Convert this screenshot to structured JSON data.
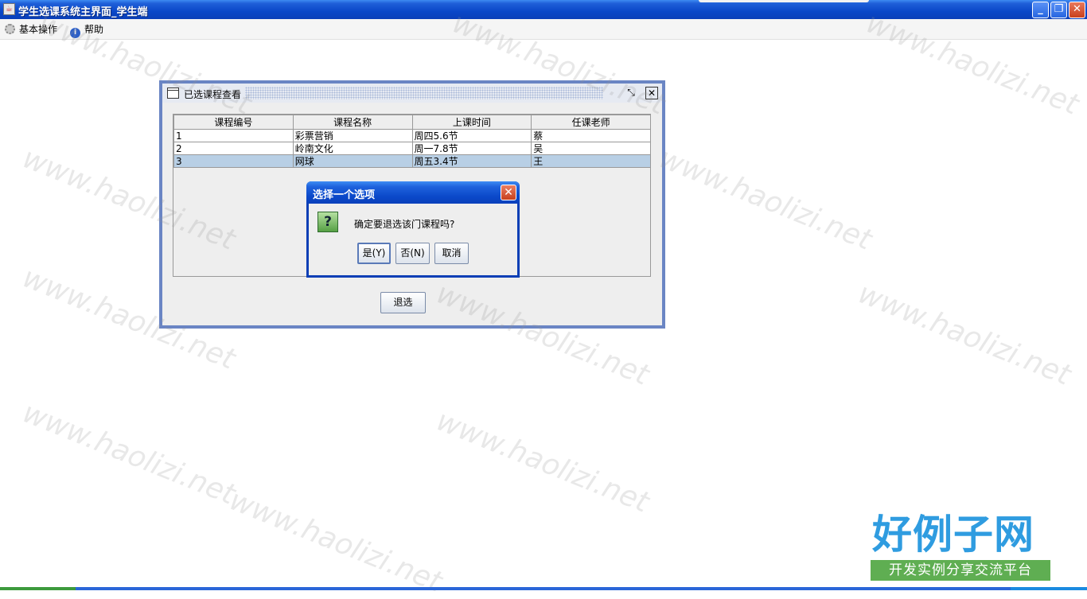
{
  "window": {
    "title": "学生选课系统主界面_学生端",
    "minimize": "_",
    "restore": "❐",
    "close": "✕"
  },
  "menu": {
    "items": [
      {
        "label": "基本操作",
        "icon": "gear-icon"
      },
      {
        "label": "帮助",
        "icon": "info-icon"
      }
    ]
  },
  "internal_frame": {
    "title": "已选课程查看",
    "restore_glyph": "⤡",
    "close_glyph": "✕",
    "table": {
      "headers": [
        "课程编号",
        "课程名称",
        "上课时间",
        "任课老师"
      ],
      "rows": [
        [
          "1",
          "彩票营销",
          "周四5.6节",
          "蔡"
        ],
        [
          "2",
          "岭南文化",
          "周一7.8节",
          "吴"
        ],
        [
          "3",
          "网球",
          "周五3.4节",
          "王"
        ]
      ],
      "selected_row": 2
    },
    "drop_button": "退选"
  },
  "dialog": {
    "title": "选择一个选项",
    "close_glyph": "✕",
    "message": "确定要退选该门课程吗?",
    "question_glyph": "?",
    "buttons": {
      "yes": "是(Y)",
      "no": "否(N)",
      "cancel": "取消"
    }
  },
  "branding": {
    "logo_text": "好例子网",
    "logo_subtitle": "开发实例分享交流平台",
    "watermark": "www.haolizi.net",
    "logo_color": "#2f9ce0",
    "subtitle_bg": "#5fae52"
  }
}
